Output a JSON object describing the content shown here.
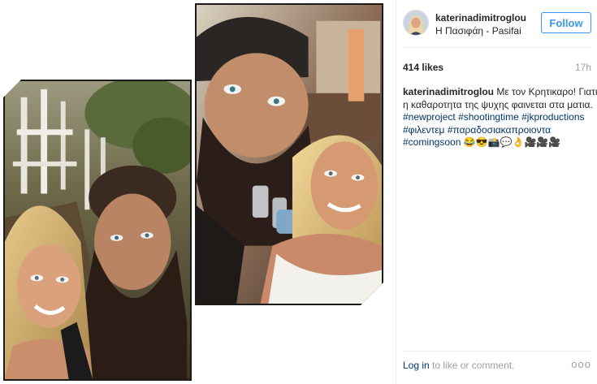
{
  "post": {
    "username": "katerinadimitroglou",
    "location": "Η Πασιφάη - Pasifai",
    "follow_label": "Follow",
    "likes": "414 likes",
    "time": "17h",
    "caption": {
      "author": "katerinadimitroglou",
      "text_line1": " Με τον Κρητικαρο! Γιατι",
      "text_line2": "η καθαροτητα της ψυχης φαινεται στα ματια.",
      "hashtags": [
        "#newproject",
        "#shootingtime",
        "#jkproductions",
        "#φιλεντεμ",
        "#παραδοσιακαπροιοντα",
        "#comingsoon"
      ],
      "emojis": "😂😎📸💬👌🎥🎥🎥"
    },
    "footer": {
      "login_label": "Log in",
      "login_rest": " to like or comment.",
      "more_label": "ooo"
    }
  },
  "colors": {
    "link": "#003569",
    "follow": "#3897f0",
    "muted": "#a0a0a0",
    "text": "#262626"
  },
  "icons": {
    "more": "ellipsis-icon"
  }
}
